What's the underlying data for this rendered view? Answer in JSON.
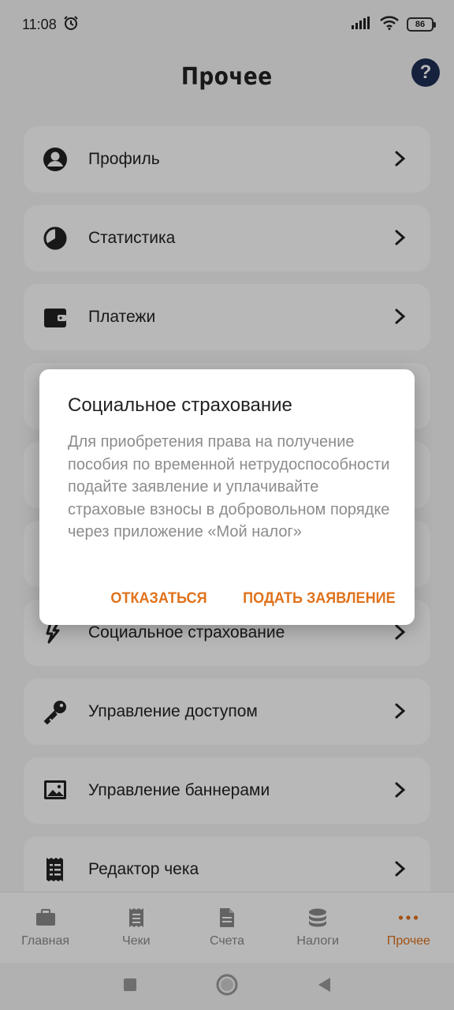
{
  "status": {
    "time": "11:08",
    "battery": "86",
    "icons": [
      "alarm-icon",
      "signal-icon",
      "wifi-icon",
      "battery-icon"
    ]
  },
  "header": {
    "title": "Прочее",
    "help_label": "?"
  },
  "menu": {
    "items": [
      {
        "label": "Профиль",
        "icon": "profile-icon"
      },
      {
        "label": "Статистика",
        "icon": "pie-chart-icon"
      },
      {
        "label": "Платежи",
        "icon": "wallet-icon"
      },
      {
        "label": "Социальное страхование",
        "icon": "social-insurance-icon"
      },
      {
        "label": "Управление доступом",
        "icon": "key-icon"
      },
      {
        "label": "Управление баннерами",
        "icon": "image-icon"
      },
      {
        "label": "Редактор чека",
        "icon": "receipt-icon"
      }
    ]
  },
  "dialog": {
    "title": "Социальное страхование",
    "body": "Для приобретения права на получение пособия по временной нетрудоспособности подайте заявление и уплачивайте страховые взносы в добровольном порядке через приложение «Мой налог»",
    "decline_label": "ОТКАЗАТЬСЯ",
    "submit_label": "ПОДАТЬ ЗАЯВЛЕНИЕ"
  },
  "bottom_nav": {
    "tabs": [
      {
        "label": "Главная",
        "icon": "briefcase-icon",
        "active": false
      },
      {
        "label": "Чеки",
        "icon": "receipt-icon",
        "active": false
      },
      {
        "label": "Счета",
        "icon": "document-icon",
        "active": false
      },
      {
        "label": "Налоги",
        "icon": "coins-icon",
        "active": false
      },
      {
        "label": "Прочее",
        "icon": "more-dots-icon",
        "active": true
      }
    ]
  },
  "colors": {
    "accent": "#e0721c",
    "help_bg": "#1f2f55",
    "inactive": "#8a8a8a"
  }
}
